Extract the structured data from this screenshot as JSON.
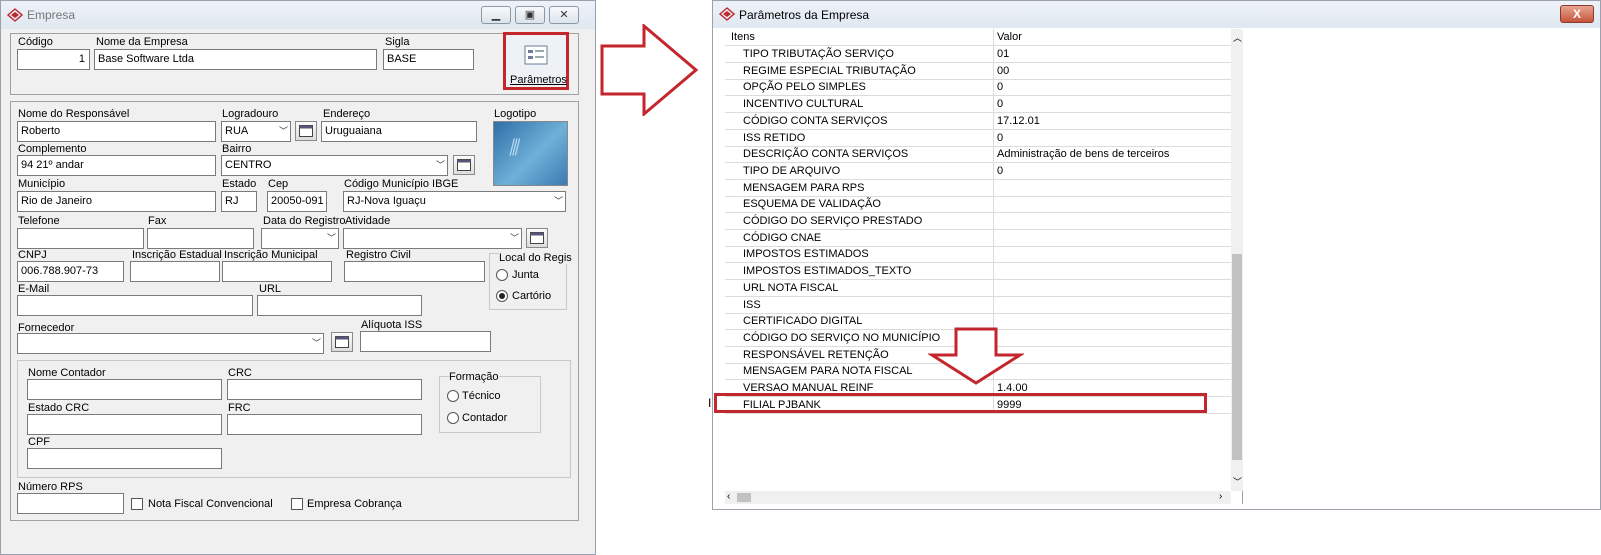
{
  "left_window": {
    "title": "Empresa",
    "codigo_label": "Código",
    "codigo_value": "1",
    "nome_empresa_label": "Nome da Empresa",
    "nome_empresa_value": "Base Software Ltda",
    "sigla_label": "Sigla",
    "sigla_value": "BASE",
    "parametros_label": "Parâmetros",
    "responsavel_label": "Nome do Responsável",
    "responsavel_value": "Roberto",
    "logradouro_label": "Logradouro",
    "logradouro_value": "RUA",
    "endereco_label": "Endereço",
    "endereco_value": "Uruguaiana",
    "logotipo_label": "Logotipo",
    "complemento_label": "Complemento",
    "complemento_value": "94 21º andar",
    "bairro_label": "Bairro",
    "bairro_value": "CENTRO",
    "municipio_label": "Município",
    "municipio_value": "Rio de Janeiro",
    "estado_label": "Estado",
    "estado_value": "RJ",
    "cep_label": "Cep",
    "cep_value": "20050-091",
    "codigo_ibge_label": "Código Município IBGE",
    "codigo_ibge_value": "RJ-Nova Iguaçu",
    "telefone_label": "Telefone",
    "fax_label": "Fax",
    "data_registro_label": "Data do Registro",
    "atividade_label": "Atividade",
    "cnpj_label": "CNPJ",
    "cnpj_value": "006.788.907-73",
    "inscricao_estadual_label": "Inscrição Estadual",
    "inscricao_municipal_label": "Inscrição Municipal",
    "registro_civil_label": "Registro Civil",
    "local_registro_label": "Local do Regis",
    "junta_label": "Junta",
    "cartorio_label": "Cartório",
    "email_label": "E-Mail",
    "url_label": "URL",
    "fornecedor_label": "Fornecedor",
    "aliquota_iss_label": "Alíquota ISS",
    "nome_contador_label": "Nome  Contador",
    "crc_label": "CRC",
    "formacao_label": "Formação",
    "tecnico_label": "Técnico",
    "contador_label": "Contador",
    "estado_crc_label": "Estado CRC",
    "frc_label": "FRC",
    "cpf_label": "CPF",
    "numero_rps_label": "Número RPS",
    "nota_fiscal_label": "Nota Fiscal Convencional",
    "empresa_cobranca_label": "Empresa Cobrança"
  },
  "right_window": {
    "title": "Parâmetros da Empresa",
    "close_label": "X",
    "col_items": "Itens",
    "col_value": "Valor",
    "rows": [
      {
        "item": "TIPO TRIBUTAÇÃO SERVIÇO",
        "value": "01"
      },
      {
        "item": "REGIME ESPECIAL TRIBUTAÇÃO",
        "value": "00"
      },
      {
        "item": "OPÇÃO PELO SIMPLES",
        "value": "0"
      },
      {
        "item": "INCENTIVO CULTURAL",
        "value": "0"
      },
      {
        "item": "CÓDIGO CONTA SERVIÇOS",
        "value": "17.12.01"
      },
      {
        "item": "ISS RETIDO",
        "value": "0"
      },
      {
        "item": "DESCRIÇÃO CONTA SERVIÇOS",
        "value": "Administração de bens de terceiros"
      },
      {
        "item": "TIPO DE ARQUIVO",
        "value": "0"
      },
      {
        "item": "MENSAGEM PARA RPS",
        "value": ""
      },
      {
        "item": "ESQUEMA DE VALIDAÇÃO",
        "value": ""
      },
      {
        "item": "CÓDIGO DO SERVIÇO PRESTADO",
        "value": ""
      },
      {
        "item": "CÓDIGO CNAE",
        "value": ""
      },
      {
        "item": "IMPOSTOS ESTIMADOS",
        "value": ""
      },
      {
        "item": "IMPOSTOS ESTIMADOS_TEXTO",
        "value": ""
      },
      {
        "item": "URL NOTA FISCAL",
        "value": ""
      },
      {
        "item": "ISS",
        "value": ""
      },
      {
        "item": "CERTIFICADO DIGITAL",
        "value": ""
      },
      {
        "item": "CÓDIGO DO SERVIÇO NO MUNICÍPIO",
        "value": ""
      },
      {
        "item": "RESPONSÁVEL RETENÇÃO",
        "value": ""
      },
      {
        "item": "MENSAGEM PARA NOTA FISCAL",
        "value": ""
      },
      {
        "item": "VERSAO MANUAL REINF",
        "value": "1.4.00"
      },
      {
        "item": "FILIAL PJBANK",
        "value": "9999"
      }
    ]
  },
  "colors": {
    "highlight": "#c4262e"
  }
}
